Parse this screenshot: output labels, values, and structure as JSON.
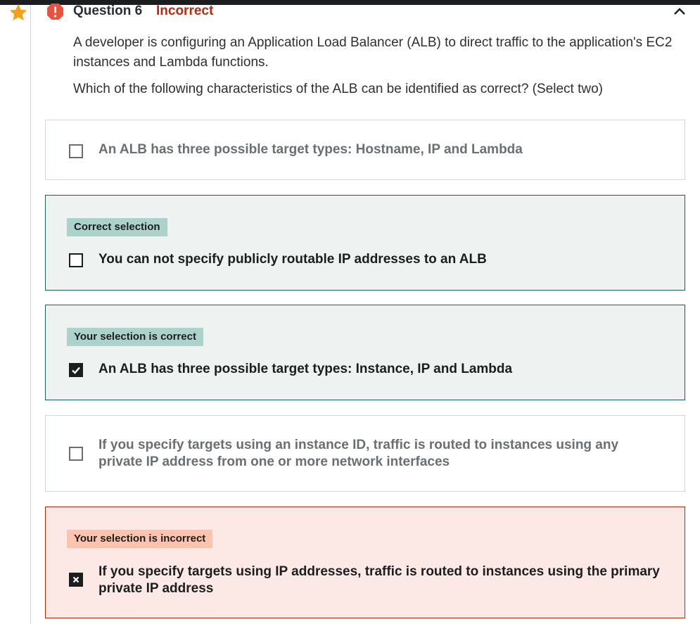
{
  "question": {
    "number_label": "Question 6",
    "status_label": "Incorrect",
    "prompt": "A developer is configuring an Application Load Balancer (ALB) to direct traffic to the application's EC2 instances and Lambda functions.",
    "instruction": "Which of the following characteristics of the ALB can be identified as correct? (Select two)"
  },
  "options": [
    {
      "text": "An ALB has three possible target types: Hostname, IP and Lambda",
      "badge": "",
      "checked": false
    },
    {
      "text": "You can not specify publicly routable IP addresses to an ALB",
      "badge": "Correct selection",
      "checked": false
    },
    {
      "text": "An ALB has three possible target types: Instance, IP and Lambda",
      "badge": "Your selection is correct",
      "checked": true
    },
    {
      "text": "If you specify targets using an instance ID, traffic is routed to instances using any private IP address from one or more network interfaces",
      "badge": "",
      "checked": false
    },
    {
      "text": "If you specify targets using IP addresses, traffic is routed to instances using the primary private IP address",
      "badge": "Your selection is incorrect",
      "checked": true
    }
  ],
  "colors": {
    "incorrect": "#b32d0f",
    "correct_border": "#1e6055",
    "correct_bg": "#eef3f2",
    "correct_badge": "#acd2cc",
    "wrong_bg": "#fce9e6",
    "wrong_badge": "#fec3ad",
    "star": "#f3a11c"
  },
  "icons": {
    "bookmark": "star-icon",
    "status": "alert-icon",
    "collapse": "chevron-up-icon"
  }
}
